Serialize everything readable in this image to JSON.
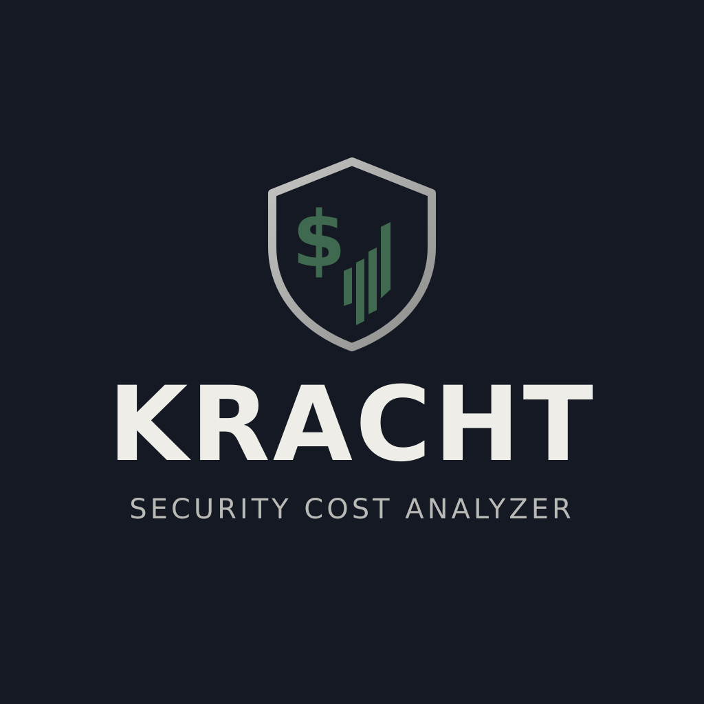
{
  "brand": {
    "name": "KRACHT",
    "tagline": "SECURITY COST ANALYZER"
  },
  "emblem": {
    "shape": "shield",
    "icons": [
      "dollar-sign-icon",
      "rising-bar-chart-icon"
    ],
    "bar_count": 4
  },
  "colors": {
    "background": "#141923",
    "shield_outline": "#A9A9A9",
    "accent_green": "#3F6A4F",
    "wordmark": "#EEEDE7",
    "tagline": "#B9B9B6"
  }
}
